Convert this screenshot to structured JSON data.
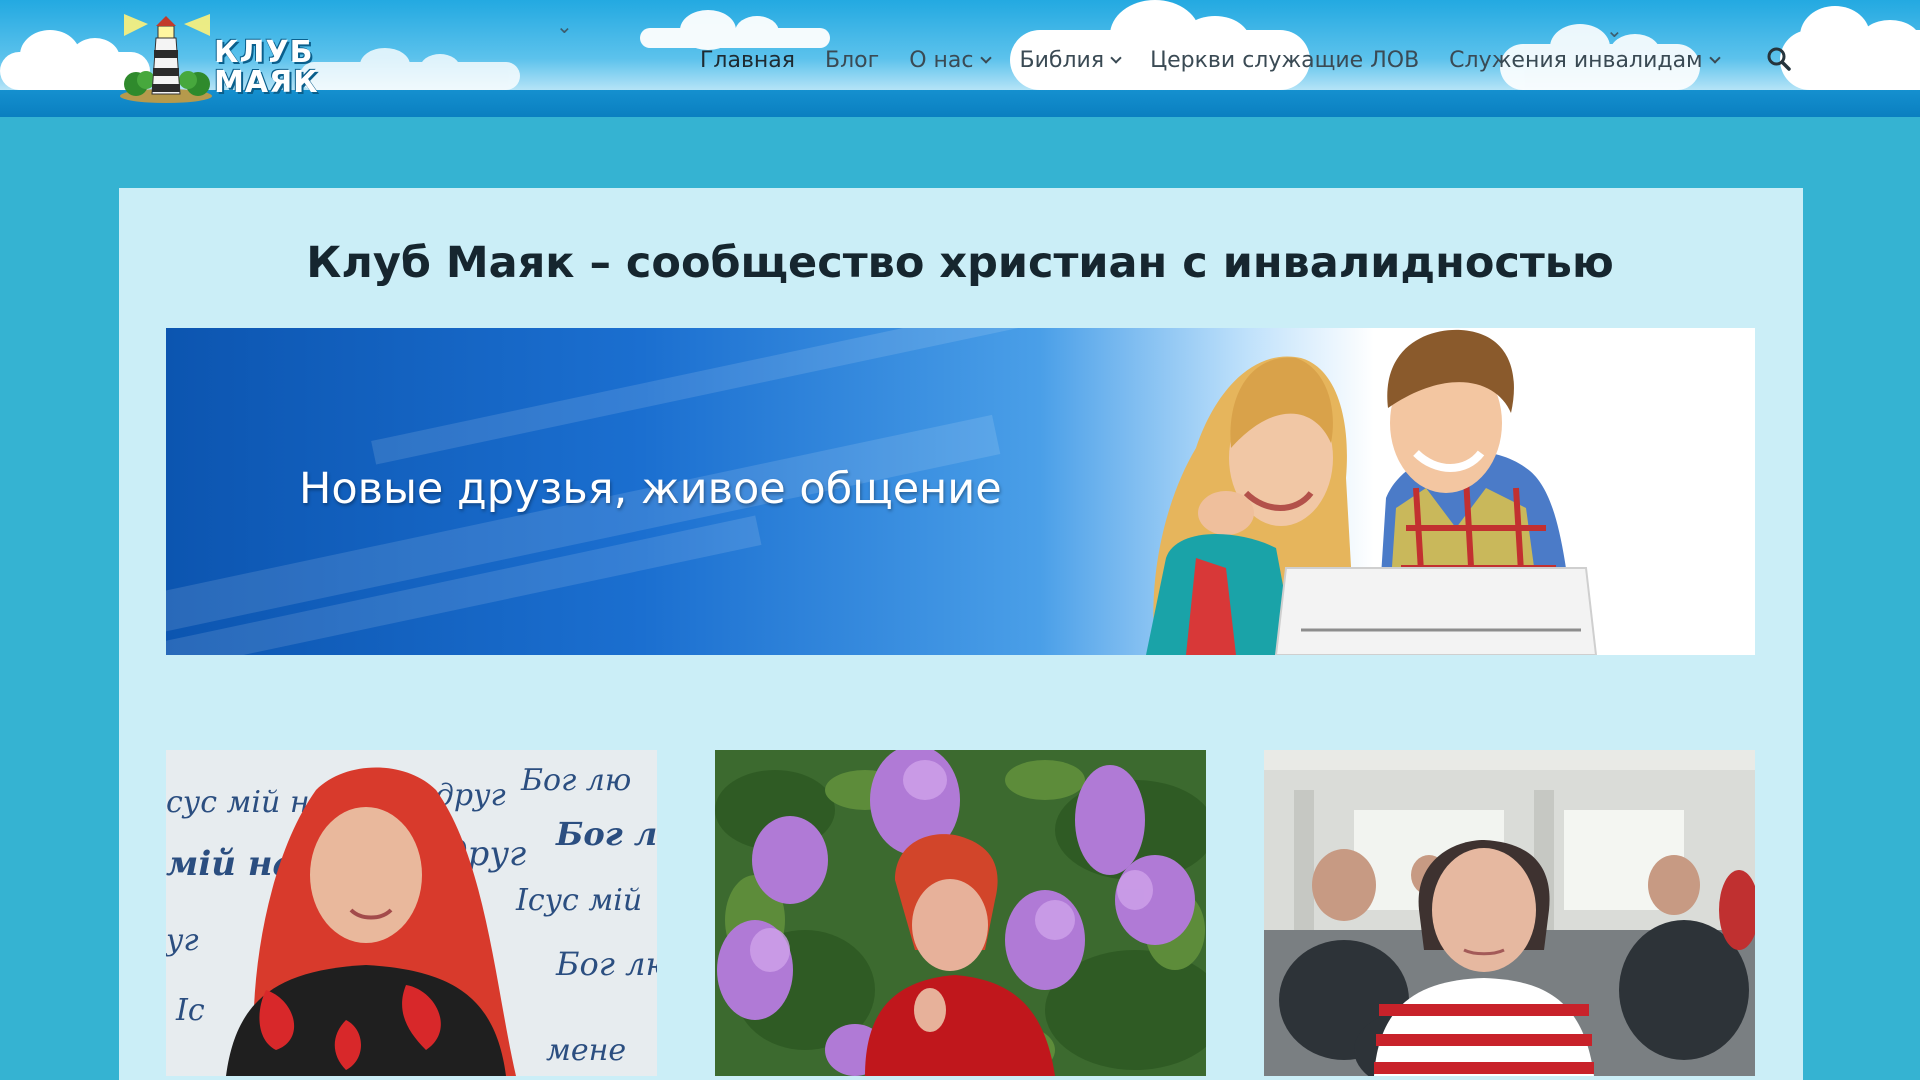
{
  "site": {
    "logo_line1": "КЛУБ",
    "logo_line2": "МАЯК"
  },
  "nav": {
    "items": [
      {
        "label": "Главная",
        "dropdown": false,
        "active": true
      },
      {
        "label": "Блог",
        "dropdown": false,
        "active": false
      },
      {
        "label": "О нас",
        "dropdown": true,
        "active": false
      },
      {
        "label": "Библия",
        "dropdown": true,
        "active": false
      },
      {
        "label": "Церкви служащие ЛОВ",
        "dropdown": false,
        "active": false
      },
      {
        "label": "Служения инвалидам",
        "dropdown": true,
        "active": false
      }
    ],
    "search_icon": "search-icon"
  },
  "main": {
    "title": "Клуб Маяк – сообщество христиан с инвалидностью",
    "banner_text": "Новые друзья, живое общение"
  },
  "photo1": {
    "wall_text": [
      "сус мій най",
      "й друг",
      "Бог лю",
      "мій найк",
      "друг",
      "Бог л",
      "Ісус мій",
      "уг",
      "Бог лю",
      "Іс",
      "мене"
    ]
  },
  "colors": {
    "page_bg": "#35b3d2",
    "card_bg": "#cbeef7",
    "header_band": "#0a7fc0",
    "title_text": "#16262f"
  }
}
